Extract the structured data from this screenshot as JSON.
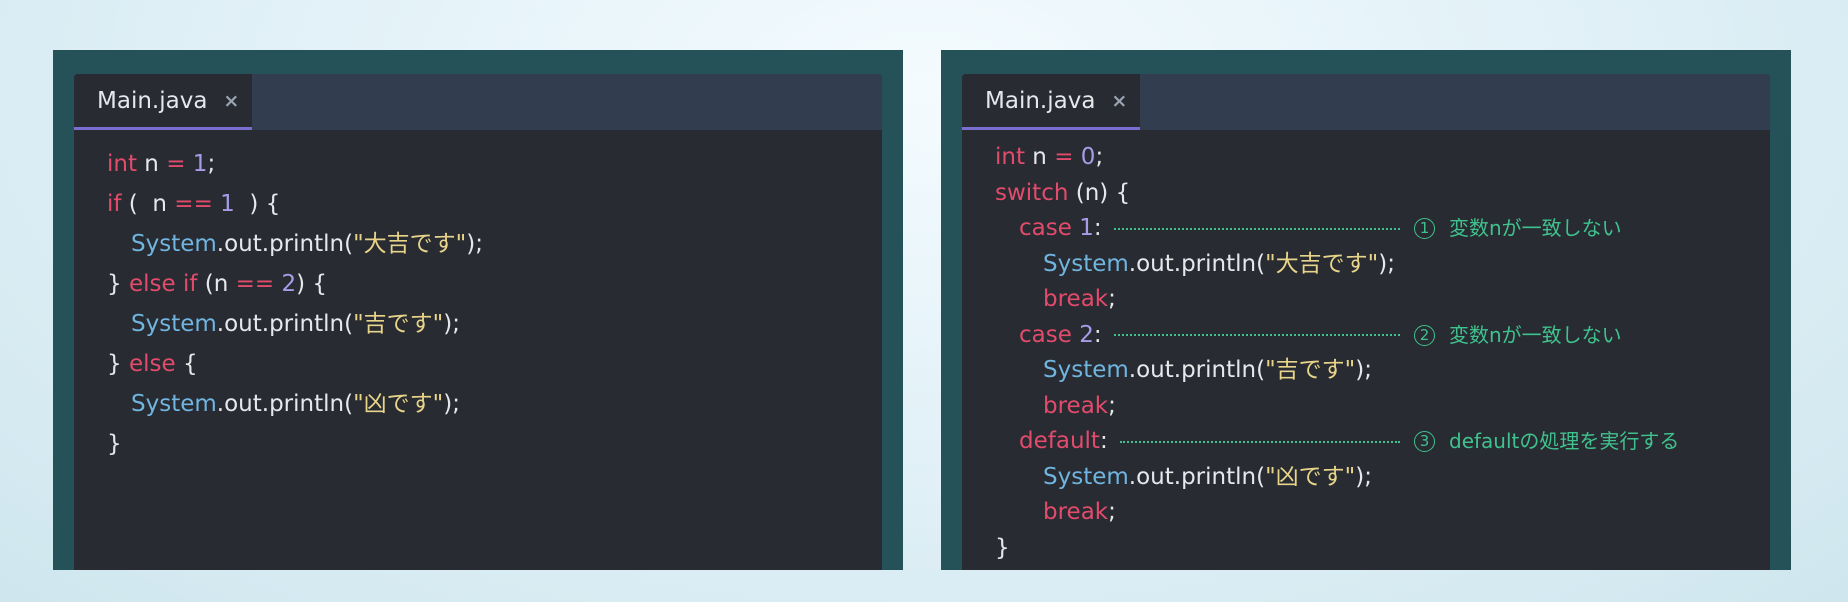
{
  "left_editor": {
    "tab": {
      "label": "Main.java",
      "close": "×"
    },
    "lines": [
      {
        "indent": 0,
        "tokens": [
          {
            "t": "int",
            "c": "kw"
          },
          {
            "t": " n ",
            "c": "txt"
          },
          {
            "t": "=",
            "c": "kw"
          },
          {
            "t": " ",
            "c": "txt"
          },
          {
            "t": "1",
            "c": "num"
          },
          {
            "t": ";",
            "c": "txt"
          }
        ]
      },
      {
        "indent": 0,
        "tokens": [
          {
            "t": "if",
            "c": "kw"
          },
          {
            "t": " (  n ",
            "c": "txt"
          },
          {
            "t": "==",
            "c": "kw"
          },
          {
            "t": " ",
            "c": "txt"
          },
          {
            "t": "1",
            "c": "num"
          },
          {
            "t": "  ) {",
            "c": "txt"
          }
        ]
      },
      {
        "indent": 1,
        "tokens": [
          {
            "t": "System",
            "c": "cls"
          },
          {
            "t": ".out.println(",
            "c": "txt"
          },
          {
            "t": "\"大吉です\"",
            "c": "str"
          },
          {
            "t": ");",
            "c": "txt"
          }
        ]
      },
      {
        "indent": 0,
        "tokens": [
          {
            "t": "} ",
            "c": "txt"
          },
          {
            "t": "else if",
            "c": "kw"
          },
          {
            "t": " (n ",
            "c": "txt"
          },
          {
            "t": "==",
            "c": "kw"
          },
          {
            "t": " ",
            "c": "txt"
          },
          {
            "t": "2",
            "c": "num"
          },
          {
            "t": ") {",
            "c": "txt"
          }
        ]
      },
      {
        "indent": 1,
        "tokens": [
          {
            "t": "System",
            "c": "cls"
          },
          {
            "t": ".out.println(",
            "c": "txt"
          },
          {
            "t": "\"吉です\"",
            "c": "str"
          },
          {
            "t": ");",
            "c": "txt"
          }
        ]
      },
      {
        "indent": 0,
        "tokens": [
          {
            "t": "} ",
            "c": "txt"
          },
          {
            "t": "else",
            "c": "kw"
          },
          {
            "t": " {",
            "c": "txt"
          }
        ]
      },
      {
        "indent": 1,
        "tokens": [
          {
            "t": "System",
            "c": "cls"
          },
          {
            "t": ".out.println(",
            "c": "txt"
          },
          {
            "t": "\"凶です\"",
            "c": "str"
          },
          {
            "t": ");",
            "c": "txt"
          }
        ]
      },
      {
        "indent": 0,
        "tokens": [
          {
            "t": "}",
            "c": "txt"
          }
        ]
      }
    ]
  },
  "right_editor": {
    "tab": {
      "label": "Main.java",
      "close": "×"
    },
    "lines": [
      {
        "indent": 0,
        "tokens": [
          {
            "t": "int",
            "c": "kw"
          },
          {
            "t": " n ",
            "c": "txt"
          },
          {
            "t": "=",
            "c": "kw"
          },
          {
            "t": " ",
            "c": "txt"
          },
          {
            "t": "0",
            "c": "num"
          },
          {
            "t": ";",
            "c": "txt"
          }
        ]
      },
      {
        "indent": 0,
        "tokens": [
          {
            "t": "switch",
            "c": "kw"
          },
          {
            "t": " (n) {",
            "c": "txt"
          }
        ]
      },
      {
        "indent": 1,
        "tokens": [
          {
            "t": "case",
            "c": "kw"
          },
          {
            "t": " ",
            "c": "txt"
          },
          {
            "t": "1",
            "c": "num"
          },
          {
            "t": ":",
            "c": "txt"
          }
        ],
        "annotation": {
          "marker": "1",
          "text": "変数nが一致しない"
        }
      },
      {
        "indent": 2,
        "tokens": [
          {
            "t": "System",
            "c": "cls"
          },
          {
            "t": ".out.println(",
            "c": "txt"
          },
          {
            "t": "\"大吉です\"",
            "c": "str"
          },
          {
            "t": ");",
            "c": "txt"
          }
        ]
      },
      {
        "indent": 2,
        "tokens": [
          {
            "t": "break",
            "c": "kw"
          },
          {
            "t": ";",
            "c": "txt"
          }
        ]
      },
      {
        "indent": 1,
        "tokens": [
          {
            "t": "case",
            "c": "kw"
          },
          {
            "t": " ",
            "c": "txt"
          },
          {
            "t": "2",
            "c": "num"
          },
          {
            "t": ":",
            "c": "txt"
          }
        ],
        "annotation": {
          "marker": "2",
          "text": "変数nが一致しない"
        }
      },
      {
        "indent": 2,
        "tokens": [
          {
            "t": "System",
            "c": "cls"
          },
          {
            "t": ".out.println(",
            "c": "txt"
          },
          {
            "t": "\"吉です\"",
            "c": "str"
          },
          {
            "t": ");",
            "c": "txt"
          }
        ]
      },
      {
        "indent": 2,
        "tokens": [
          {
            "t": "break",
            "c": "kw"
          },
          {
            "t": ";",
            "c": "txt"
          }
        ]
      },
      {
        "indent": 1,
        "tokens": [
          {
            "t": "default",
            "c": "kw"
          },
          {
            "t": ":",
            "c": "txt"
          }
        ],
        "annotation": {
          "marker": "3",
          "text": "defaultの処理を実行する"
        }
      },
      {
        "indent": 2,
        "tokens": [
          {
            "t": "System",
            "c": "cls"
          },
          {
            "t": ".out.println(",
            "c": "txt"
          },
          {
            "t": "\"凶です\"",
            "c": "str"
          },
          {
            "t": ");",
            "c": "txt"
          }
        ]
      },
      {
        "indent": 2,
        "tokens": [
          {
            "t": "break",
            "c": "kw"
          },
          {
            "t": ";",
            "c": "txt"
          }
        ]
      },
      {
        "indent": 0,
        "tokens": [
          {
            "t": "}",
            "c": "txt"
          }
        ]
      }
    ]
  }
}
